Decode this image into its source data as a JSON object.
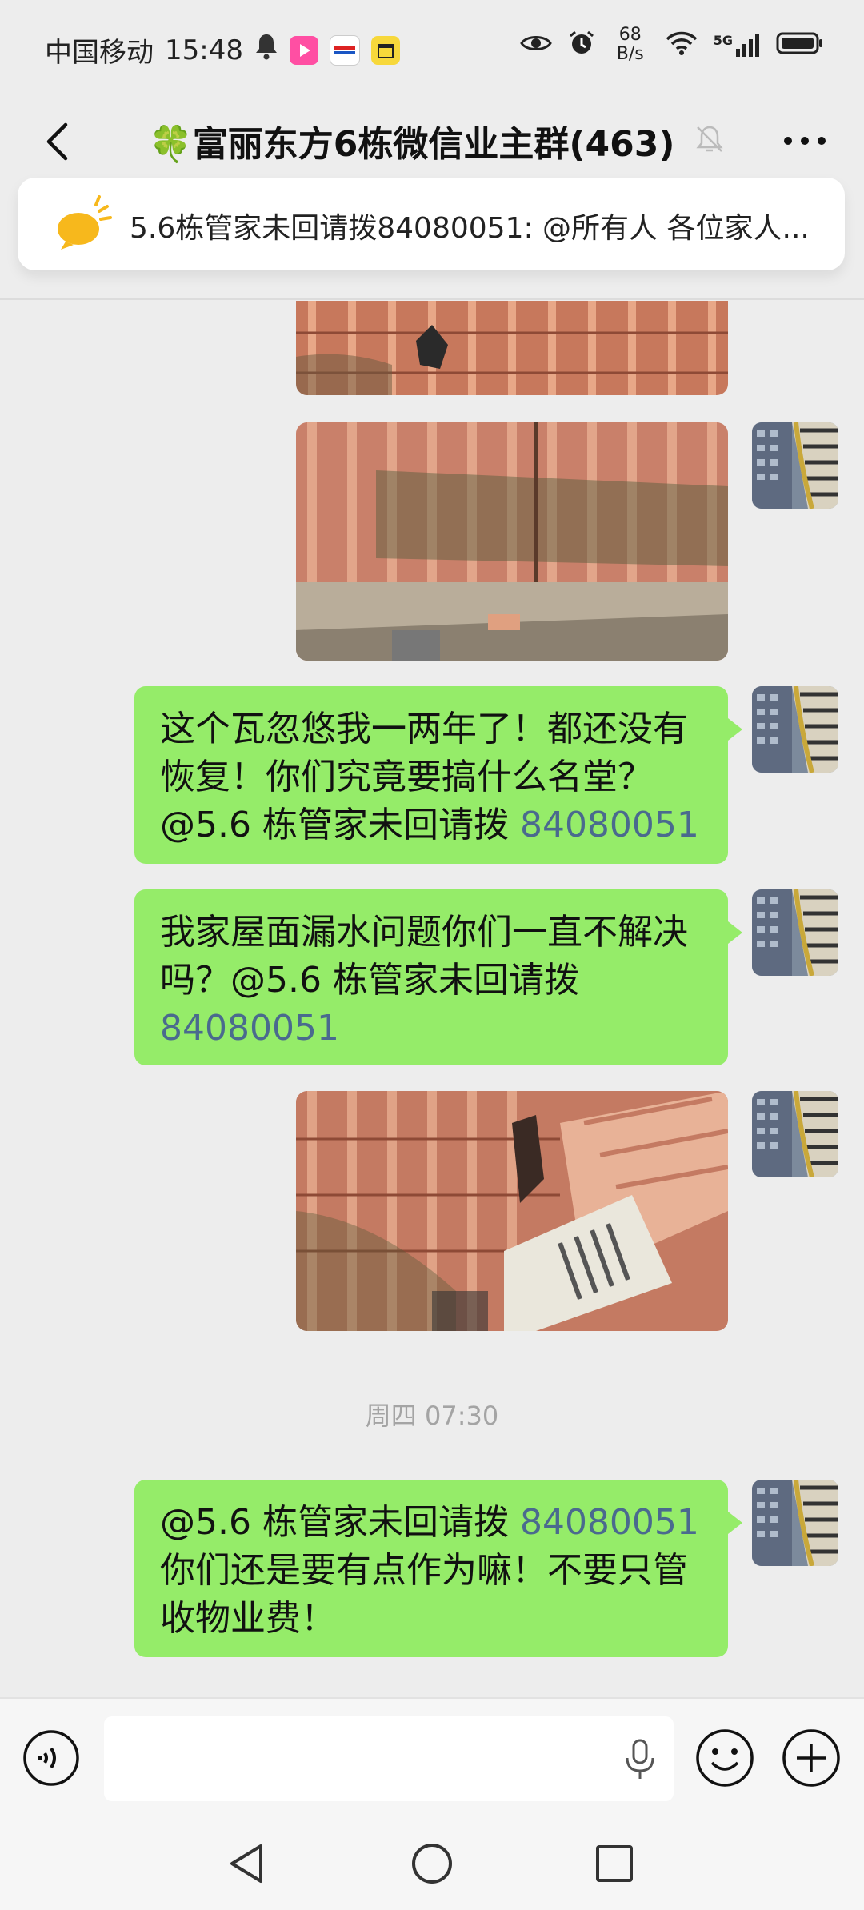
{
  "status_bar": {
    "carrier": "中国移动",
    "time": "15:48",
    "net_speed_value": "68",
    "net_speed_unit": "B/s",
    "signal_label": "5G"
  },
  "header": {
    "title": "🍀富丽东方6栋微信业主群(463)"
  },
  "pinned": {
    "text": "5.6栋管家未回请拨84080051: @所有人 各位家人..."
  },
  "messages": [
    {
      "type": "text",
      "text": "这个瓦忽悠我一两年了！都还没有恢复！你们究竟要搞什么名堂？@5.6 栋管家未回请拨 ",
      "number": "84080051"
    },
    {
      "type": "text",
      "text": "我家屋面漏水问题你们一直不解决吗？@5.6 栋管家未回请拨 ",
      "number": "84080051"
    },
    {
      "type": "text",
      "prefix": "@5.6 栋管家未回请拨 ",
      "number": "84080051",
      "suffix": " 你们还是要有点作为嘛！不要只管收物业费！"
    }
  ],
  "timestamp": "周四 07:30",
  "colors": {
    "bubble_green": "#95ec69",
    "link_blue": "#4a6a8e",
    "background": "#ededed"
  },
  "icons": [
    "back-arrow-icon",
    "mute-bell-icon",
    "more-dots-icon",
    "megaphone-icon",
    "voice-icon",
    "mic-icon",
    "emoji-icon",
    "plus-icon",
    "nav-back-icon",
    "nav-home-icon",
    "nav-recents-icon"
  ]
}
